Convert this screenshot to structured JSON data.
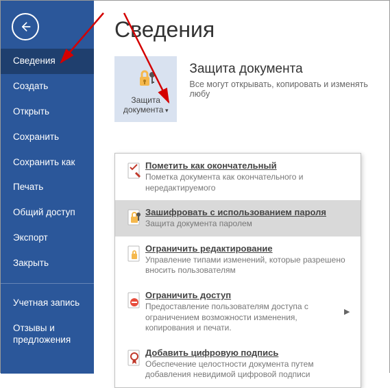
{
  "sidebar": {
    "items": [
      {
        "label": "Сведения",
        "selected": true
      },
      {
        "label": "Создать"
      },
      {
        "label": "Открыть"
      },
      {
        "label": "Сохранить"
      },
      {
        "label": "Сохранить как"
      },
      {
        "label": "Печать"
      },
      {
        "label": "Общий доступ"
      },
      {
        "label": "Экспорт"
      },
      {
        "label": "Закрыть"
      }
    ],
    "footer": [
      {
        "label": "Учетная запись"
      },
      {
        "label": "Отзывы и предложения"
      }
    ]
  },
  "main": {
    "title": "Сведения",
    "protect": {
      "button_label": "Защита документа",
      "heading": "Защита документа",
      "desc": "Все могут открывать, копировать и изменять любу"
    }
  },
  "dropdown": {
    "items": [
      {
        "title": "Пометить как окончательный",
        "sub": "Пометка документа как окончательного и нередактируемого",
        "icon": "final"
      },
      {
        "title": "Зашифровать с использованием пароля",
        "sub": "Защита документа паролем",
        "icon": "encrypt",
        "hover": true
      },
      {
        "title": "Ограничить редактирование",
        "sub": "Управление типами изменений, которые разрешено вносить пользователям",
        "icon": "restrict-edit"
      },
      {
        "title": "Ограничить доступ",
        "sub": "Предоставление пользователям доступа с ограничением возможности изменения, копирования и печати.",
        "icon": "restrict-access",
        "submenu": true
      },
      {
        "title": "Добавить цифровую подпись",
        "sub": "Обеспечение целостности документа путем добавления невидимой цифровой подписи",
        "icon": "signature"
      }
    ]
  }
}
